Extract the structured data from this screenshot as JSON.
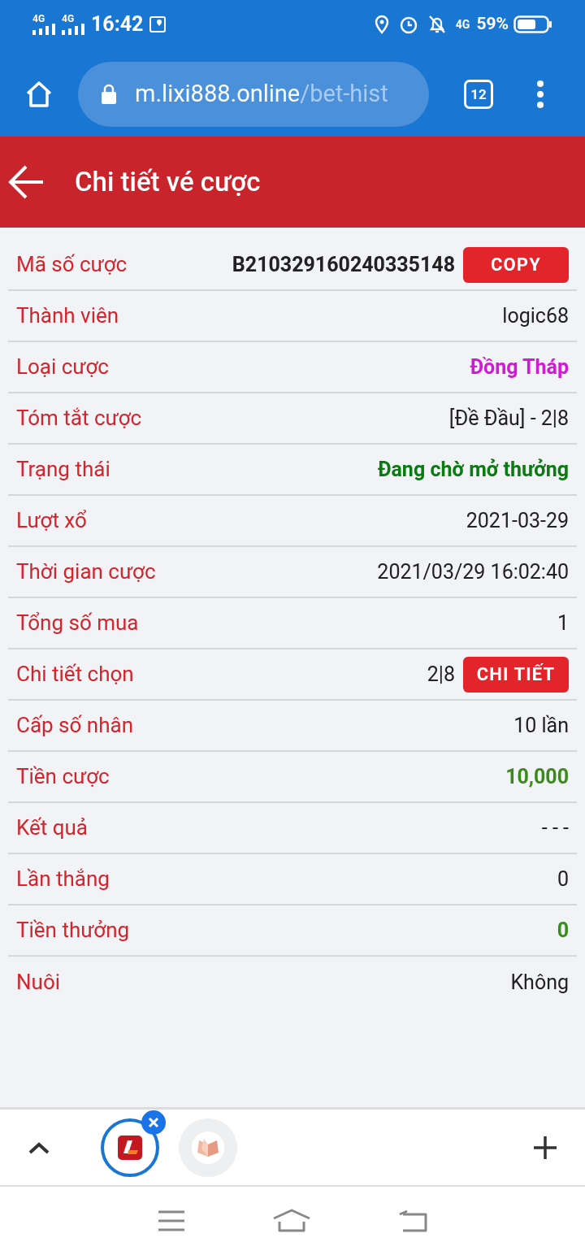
{
  "status_bar": {
    "network_1": "4G",
    "network_2": "4G",
    "time": "16:42",
    "network_3": "4G",
    "battery": "59%"
  },
  "browser": {
    "url_host": "m.lixi888.online",
    "url_path": "/bet-hist",
    "tab_count": "12"
  },
  "header": {
    "title": "Chi tiết vé cược"
  },
  "rows": [
    {
      "label": "Mã số cược",
      "value": "B210329160240335148",
      "kind": "strong",
      "button": "COPY"
    },
    {
      "label": "Thành viên",
      "value": "logic68",
      "kind": "plain"
    },
    {
      "label": "Loại cược",
      "value": "Đồng Tháp",
      "kind": "magenta"
    },
    {
      "label": "Tóm tắt cược",
      "value": "[Đề Đầu] - 2|8",
      "kind": "plain"
    },
    {
      "label": "Trạng thái",
      "value": "Đang chờ mở thưởng",
      "kind": "green"
    },
    {
      "label": "Lượt xổ",
      "value": "2021-03-29",
      "kind": "plain"
    },
    {
      "label": "Thời gian cược",
      "value": "2021/03/29 16:02:40",
      "kind": "plain"
    },
    {
      "label": "Tổng số mua",
      "value": "1",
      "kind": "plain"
    },
    {
      "label": "Chi tiết chọn",
      "value": "2|8",
      "kind": "plain",
      "button": "CHI TIẾT"
    },
    {
      "label": "Cấp số nhân",
      "value": "10 lần",
      "kind": "plain"
    },
    {
      "label": "Tiền cược",
      "value": "10,000",
      "kind": "olive"
    },
    {
      "label": "Kết quả",
      "value": "- - -",
      "kind": "plain"
    },
    {
      "label": "Lần thắng",
      "value": "0",
      "kind": "plain"
    },
    {
      "label": "Tiền thưởng",
      "value": "0",
      "kind": "olive"
    },
    {
      "label": "Nuôi",
      "value": "Không",
      "kind": "plain"
    }
  ],
  "tabs": [
    {
      "kind": "logo",
      "selected": true
    },
    {
      "kind": "book",
      "selected": false
    }
  ]
}
